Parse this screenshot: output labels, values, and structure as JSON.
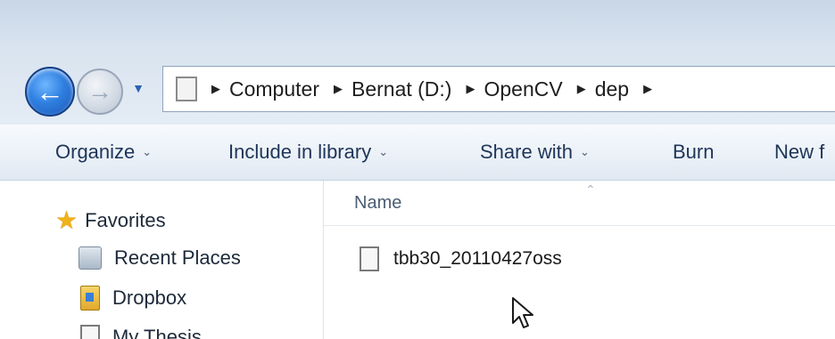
{
  "address_bar": {
    "crumbs": [
      "Computer",
      "Bernat (D:)",
      "OpenCV",
      "dep"
    ]
  },
  "commands": {
    "organize": "Organize",
    "include_in_library": "Include in library",
    "share_with": "Share with",
    "burn": "Burn",
    "new_folder": "New f"
  },
  "navigation": {
    "favorites": "Favorites",
    "recent_places": "Recent Places",
    "dropbox": "Dropbox",
    "my_thesis": "My Thesis"
  },
  "file_list": {
    "column_name": "Name",
    "files": [
      {
        "name": "tbb30_20110427oss"
      }
    ]
  },
  "icons": {
    "back": "back-arrow-icon",
    "forward": "forward-arrow-icon",
    "dropdown": "chevron-down-icon",
    "favorites": "star-icon",
    "recent_places": "recent-places-icon",
    "dropbox": "dropbox-icon",
    "document": "document-icon",
    "cursor": "mouse-pointer-icon"
  }
}
